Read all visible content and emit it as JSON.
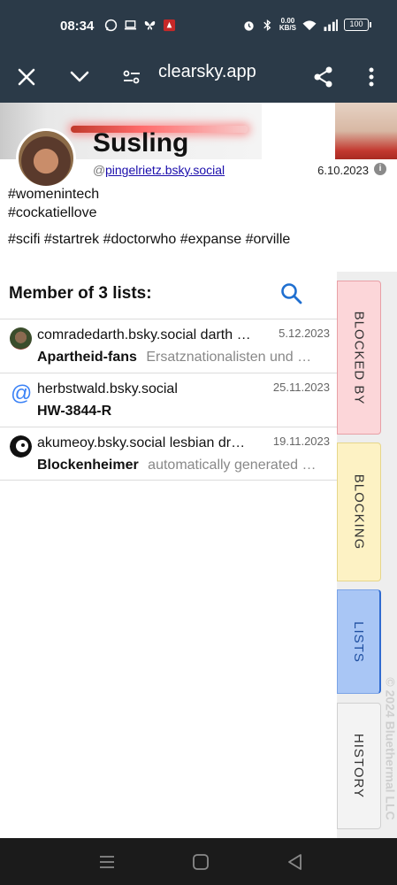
{
  "status_bar": {
    "time": "08:34",
    "net_speed_value": "0.00",
    "net_speed_unit": "KB/S",
    "battery": "100",
    "icons_left": [
      "whatsapp-icon",
      "laptop-icon",
      "butterfly-icon",
      "app-notification-icon"
    ],
    "icons_right": [
      "alarm-icon",
      "bluetooth-icon",
      "wifi-icon",
      "signal-icon"
    ]
  },
  "toolbar": {
    "url": "clearsky.app"
  },
  "profile": {
    "display_name": "Susling",
    "handle_prefix": "@",
    "handle": "pingelrietz.bsky.social",
    "joined": "6.10.2023",
    "bio_lines": [
      "#womenintech",
      "#cockatiellove",
      "#scifi #startrek #doctorwho #expanse #orville"
    ]
  },
  "lists": {
    "title": "Member of 3 lists:",
    "items": [
      {
        "author": "comradedarth.bsky.social darth …",
        "date": "5.12.2023",
        "name": "Apartheid-fans",
        "description": "Ersatznationalisten und …"
      },
      {
        "author": "herbstwald.bsky.social",
        "date": "25.11.2023",
        "name": "HW-3844-R",
        "description": ""
      },
      {
        "author": "akumeoy.bsky.social lesbian dr…",
        "date": "19.11.2023",
        "name": "Blockenheimer",
        "description": "automatically generated …"
      }
    ]
  },
  "side_tabs": {
    "blocked_by": "BLOCKED BY",
    "blocking": "BLOCKING",
    "lists": "LISTS",
    "history": "HISTORY",
    "copyright": "© 2024 Bluethermal LLC",
    "colors": {
      "blocked_by": "#fcd6d9",
      "blocking": "#fdf2c4",
      "lists": "#a9c6f5",
      "history": "#f3f3f3"
    }
  },
  "colors": {
    "bar_bg": "#2b3a48",
    "accent": "#1f6fd0",
    "link": "#1a0dab"
  }
}
